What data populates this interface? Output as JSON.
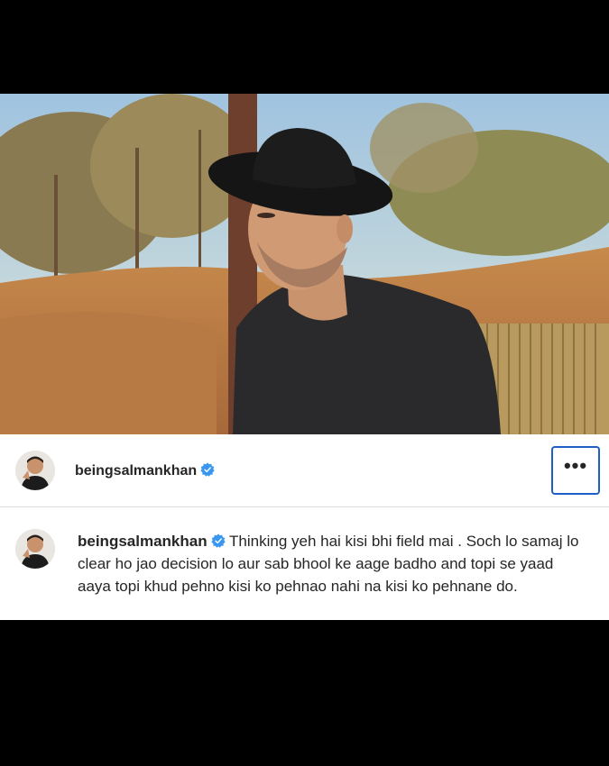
{
  "post": {
    "username": "beingsalmankhan",
    "verified": true,
    "more_label": "•••",
    "caption_text": "Thinking yeh hai kisi bhi field mai . Soch lo samaj lo clear ho jao decision lo aur sab bhool ke aage badho and topi se yaad aaya topi khud pehno kisi ko pehnao nahi na kisi ko pehnane do."
  },
  "colors": {
    "verified_badge": "#3897f0",
    "focus_outline": "#1f5ec6",
    "text": "#262626"
  },
  "icons": {
    "verified": "verified-badge-icon",
    "more": "more-options-icon"
  }
}
